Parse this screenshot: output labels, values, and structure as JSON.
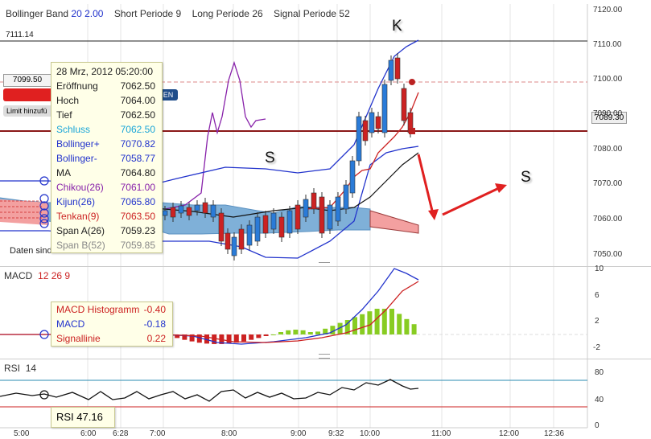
{
  "price_panel": {
    "indicator_name": "Bollinger Band",
    "bb_period": "20",
    "bb_dev": "2.00",
    "short_label": "Short Periode",
    "short_val": "9",
    "long_label": "Long Periode",
    "long_val": "26",
    "signal_label": "Signal Periode",
    "signal_val": "52",
    "level_line_label": "7111.14",
    "price_box": "7099.50",
    "current_price": "7089.30",
    "limit_btn": "Limit hinzufü",
    "blue_btn": "EN",
    "note": "Daten sind indikativ",
    "y_labels": [
      "7120.00",
      "7110.00",
      "7100.00",
      "7090.00",
      "7080.00",
      "7070.00",
      "7060.00",
      "7050.00"
    ],
    "annotations": {
      "k": "K",
      "s1": "S",
      "s2": "S"
    }
  },
  "tooltip": {
    "date": "28 Mrz, 2012 05:20:00",
    "rows": [
      {
        "label": "Eröffnung",
        "value": "7062.50",
        "color": "#222222"
      },
      {
        "label": "Hoch",
        "value": "7064.00",
        "color": "#222222"
      },
      {
        "label": "Tief",
        "value": "7062.50",
        "color": "#222222"
      },
      {
        "label": "Schluss",
        "value": "7062.50",
        "color": "#19a5d8"
      },
      {
        "label": "Bollinger+",
        "value": "7070.82",
        "color": "#2233cc"
      },
      {
        "label": "Bollinger-",
        "value": "7058.77",
        "color": "#2233cc"
      },
      {
        "label": "MA",
        "value": "7064.80",
        "color": "#222222"
      },
      {
        "label": "Chikou(26)",
        "value": "7061.00",
        "color": "#8822aa"
      },
      {
        "label": "Kijun(26)",
        "value": "7065.80",
        "color": "#2233cc"
      },
      {
        "label": "Tenkan(9)",
        "value": "7063.50",
        "color": "#cc2222"
      },
      {
        "label": "Span A(26)",
        "value": "7059.23",
        "color": "#222222"
      },
      {
        "label": "Span B(52)",
        "value": "7059.85",
        "color": "#888888"
      }
    ]
  },
  "macd_panel": {
    "name": "MACD",
    "p1": "12",
    "p2": "26",
    "p3": "9",
    "y_labels": [
      "10",
      "6",
      "2",
      "-2"
    ],
    "tooltip": [
      {
        "label": "MACD Histogramm",
        "value": "-0.40",
        "color": "#cc2222"
      },
      {
        "label": "MACD",
        "value": "-0.18",
        "color": "#2233cc"
      },
      {
        "label": "Signallinie",
        "value": "0.22",
        "color": "#cc2222"
      }
    ]
  },
  "rsi_panel": {
    "name": "RSI",
    "period": "14",
    "y_labels": [
      "80",
      "40",
      "0"
    ],
    "tooltip_label": "RSI",
    "tooltip_value": "47.16"
  },
  "x_labels": [
    "5:00",
    "6:00",
    "6:28",
    "7:00",
    "8:00",
    "9:00",
    "9:32",
    "10:00",
    "11:00",
    "12:00",
    "12:36"
  ],
  "colors": {
    "up": "#2a7bd8",
    "down": "#cc2222",
    "histogram": "#88cc22",
    "kumo": "#7fb0d8",
    "kumo_red": "#f3a0a0"
  }
}
